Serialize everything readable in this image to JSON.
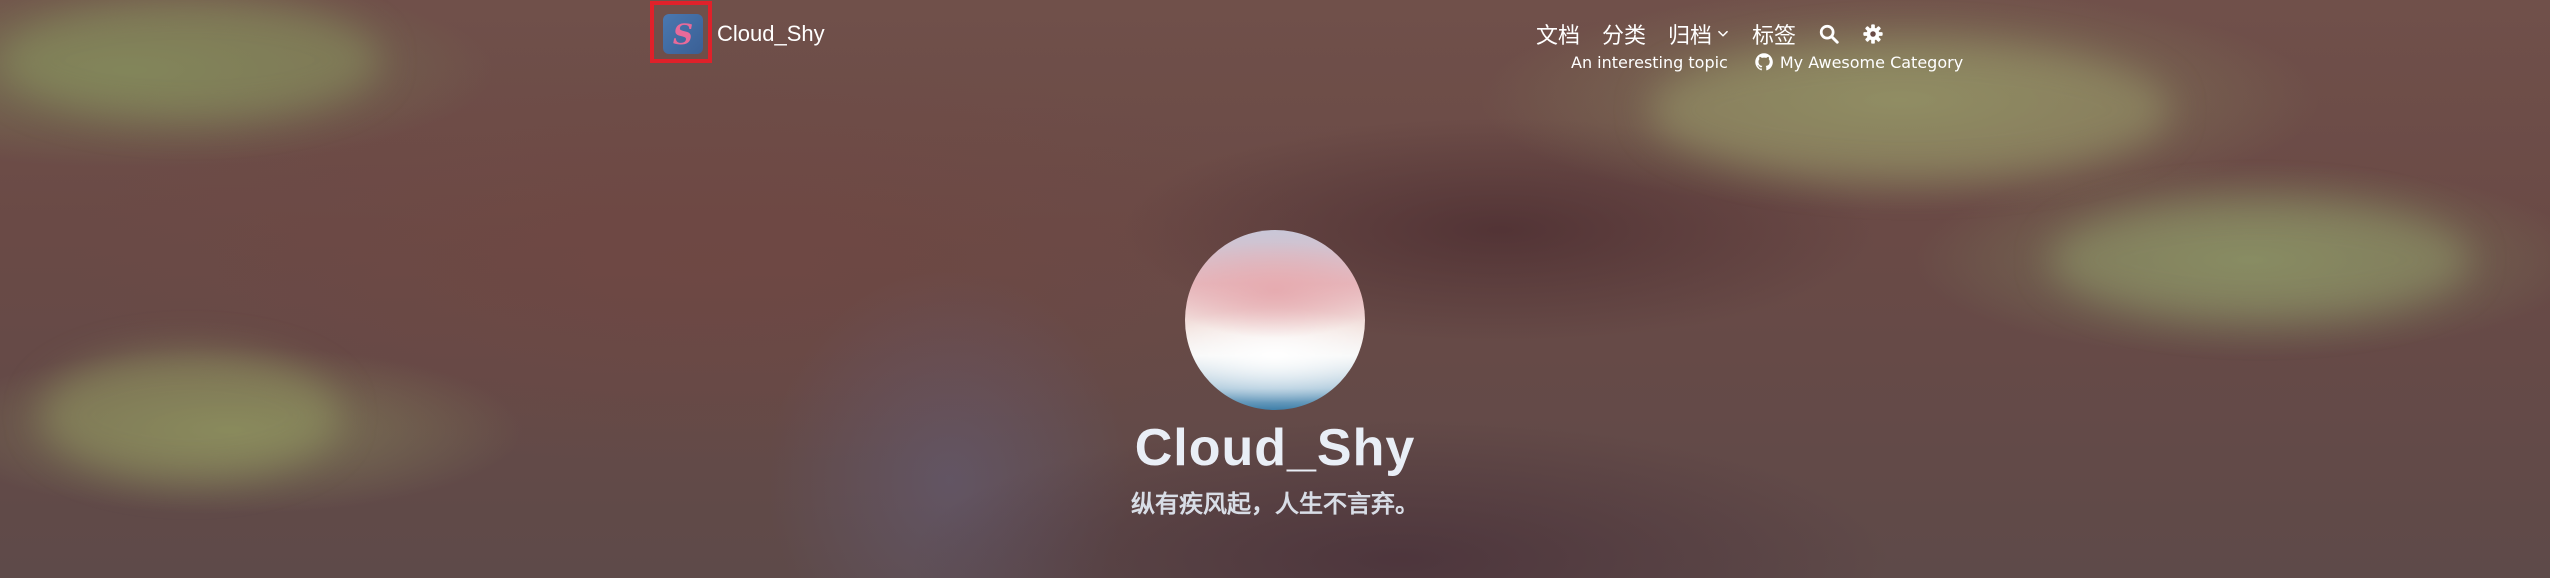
{
  "site": {
    "title": "Cloud_Shy",
    "logo_letter": "S"
  },
  "nav": {
    "items": [
      {
        "label": "文档",
        "icon": null
      },
      {
        "label": "分类",
        "icon": null
      },
      {
        "label": "归档",
        "icon": "chevron-down-icon"
      },
      {
        "label": "标签",
        "icon": null
      }
    ],
    "search_icon": "search-icon",
    "settings_icon": "gear-icon"
  },
  "subnav": {
    "items": [
      {
        "label": "An interesting topic",
        "icon": null
      },
      {
        "label": "My Awesome Category",
        "icon": "github-icon"
      }
    ]
  },
  "profile": {
    "name": "Cloud_Shy",
    "motto": "纵有疾风起，人生不言弃。"
  },
  "colors": {
    "highlight": "#e0212a",
    "logo_bg": "#4a78b0",
    "logo_letter": "#e86a9a"
  }
}
